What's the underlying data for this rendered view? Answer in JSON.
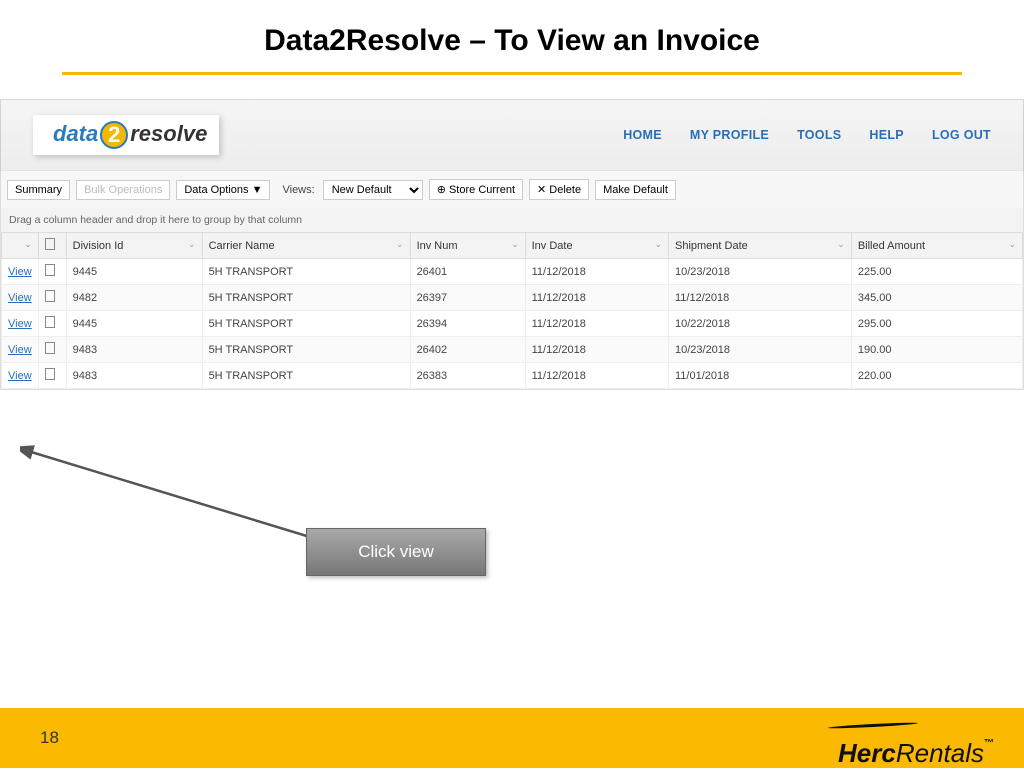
{
  "slide": {
    "title": "Data2Resolve – To View an Invoice",
    "page_number": "18"
  },
  "logo": {
    "left": "data",
    "mid": "2",
    "right": "resolve"
  },
  "nav": {
    "home": "HOME",
    "profile": "MY PROFILE",
    "tools": "TOOLS",
    "help": "HELP",
    "logout": "LOG OUT"
  },
  "toolbar": {
    "summary": "Summary",
    "bulk": "Bulk Operations",
    "data_options": "Data Options  ▼",
    "views_label": "Views:",
    "views_value": "New Default",
    "store": "Store Current",
    "delete": "Delete",
    "make_default": "Make Default"
  },
  "grouping_hint": "Drag a column header and drop it here to group by that column",
  "columns": {
    "division": "Division Id",
    "carrier": "Carrier Name",
    "invnum": "Inv Num",
    "invdate": "Inv Date",
    "shipdate": "Shipment Date",
    "billed": "Billed Amount"
  },
  "rows": [
    {
      "view": "View",
      "division": "9445",
      "carrier": "5H TRANSPORT",
      "invnum": "26401",
      "invdate": "11/12/2018",
      "shipdate": "10/23/2018",
      "billed": "225.00"
    },
    {
      "view": "View",
      "division": "9482",
      "carrier": "5H TRANSPORT",
      "invnum": "26397",
      "invdate": "11/12/2018",
      "shipdate": "11/12/2018",
      "billed": "345.00"
    },
    {
      "view": "View",
      "division": "9445",
      "carrier": "5H TRANSPORT",
      "invnum": "26394",
      "invdate": "11/12/2018",
      "shipdate": "10/22/2018",
      "billed": "295.00"
    },
    {
      "view": "View",
      "division": "9483",
      "carrier": "5H TRANSPORT",
      "invnum": "26402",
      "invdate": "11/12/2018",
      "shipdate": "10/23/2018",
      "billed": "190.00"
    },
    {
      "view": "View",
      "division": "9483",
      "carrier": "5H TRANSPORT",
      "invnum": "26383",
      "invdate": "11/12/2018",
      "shipdate": "11/01/2018",
      "billed": "220.00"
    }
  ],
  "callout": {
    "text": "Click view"
  },
  "brand": {
    "herc": "Herc",
    "rentals": "Rentals",
    "tm": "™"
  }
}
